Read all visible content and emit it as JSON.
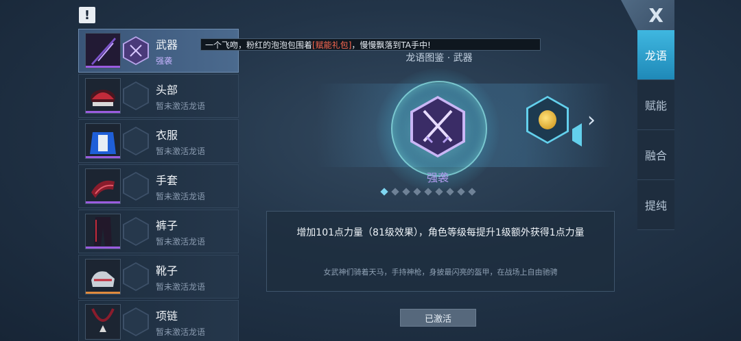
{
  "alert": {
    "label": "!"
  },
  "close": {
    "label": "X"
  },
  "ticker": {
    "prefix": "一个飞吻，粉红的泡泡包围着",
    "highlight": "[赋能礼包]",
    "suffix": "，慢慢飘落到TA手中!"
  },
  "slots": [
    {
      "name": "武器",
      "status": "强袭",
      "active": true
    },
    {
      "name": "头部",
      "status": "暂未激活龙语"
    },
    {
      "name": "衣服",
      "status": "暂未激活龙语"
    },
    {
      "name": "手套",
      "status": "暂未激活龙语"
    },
    {
      "name": "裤子",
      "status": "暂未激活龙语"
    },
    {
      "name": "靴子",
      "status": "暂未激活龙语"
    },
    {
      "name": "项链",
      "status": "暂未激活龙语"
    }
  ],
  "tabs": [
    "龙语",
    "赋能",
    "融合",
    "提纯"
  ],
  "codex": {
    "title": "龙语图鉴 · 武器",
    "emblem_name": "强袭",
    "page_count": 9,
    "active_page": 1
  },
  "effect": {
    "main": "增加101点力量（81级效果），角色等级每提升1级额外获得1点力量",
    "flavor": "女武神们骑着天马，手持神枪，身披最闪亮的盔甲，在战场上自由驰骋"
  },
  "action": {
    "label": "已激活"
  },
  "colors": {
    "accent": "#3fb7e0",
    "purple": "#b39cf0",
    "highlight": "#ff6a52"
  }
}
